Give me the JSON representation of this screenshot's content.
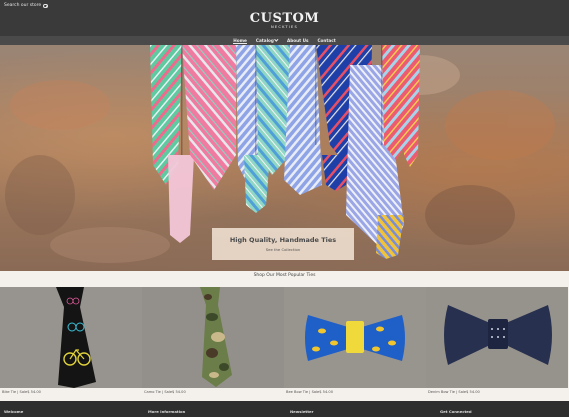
{
  "header": {
    "search_label": "Search our store",
    "logo_main": "CUSTOM",
    "logo_sub": "NECKTIES"
  },
  "nav": {
    "items": [
      {
        "label": "Home",
        "active": true
      },
      {
        "label": "Catalog",
        "has_dropdown": true
      },
      {
        "label": "About Us"
      },
      {
        "label": "Contact"
      }
    ]
  },
  "hero": {
    "title": "High Quality, Handmade Ties",
    "link": "See the Collection"
  },
  "section_title": "Shop Our Most Popular Ties",
  "products": [
    {
      "caption": "Bike Tie | Sale$ 54.00"
    },
    {
      "caption": "Camo Tie | Sale$ 54.00"
    },
    {
      "caption": "Bee Bow Tie | Sale$ 54.00"
    },
    {
      "caption": "Denim Bow Tie | Sale$ 54.00"
    }
  ],
  "footer": {
    "welcome": "Welcome",
    "more_info": "More Information",
    "newsletter": "Newsletter",
    "get_connected": "Get Connected"
  }
}
